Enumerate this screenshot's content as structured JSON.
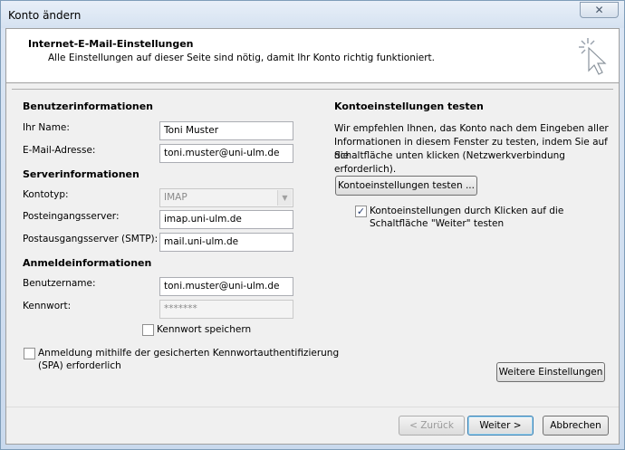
{
  "window": {
    "title": "Konto ändern",
    "close_label": "✕"
  },
  "header": {
    "title": "Internet-E-Mail-Einstellungen",
    "subtitle": "Alle Einstellungen auf dieser Seite sind nötig, damit Ihr Konto richtig funktioniert."
  },
  "user_info": {
    "section_title": "Benutzerinformationen",
    "name_label": "Ihr Name:",
    "name_value": "Toni Muster",
    "email_label": "E-Mail-Adresse:",
    "email_value": "toni.muster@uni-ulm.de"
  },
  "server_info": {
    "section_title": "Serverinformationen",
    "account_type_label": "Kontotyp:",
    "account_type_value": "IMAP",
    "incoming_label": "Posteingangsserver:",
    "incoming_value": "imap.uni-ulm.de",
    "outgoing_label": "Postausgangsserver (SMTP):",
    "outgoing_value": "mail.uni-ulm.de"
  },
  "login_info": {
    "section_title": "Anmeldeinformationen",
    "username_label": "Benutzername:",
    "username_value": "toni.muster@uni-ulm.de",
    "password_label": "Kennwort:",
    "password_value": "*******",
    "save_password_label": "Kennwort speichern",
    "save_password_checked": false,
    "spa_label_line1": "Anmeldung mithilfe der gesicherten Kennwortauthentifizierung",
    "spa_label_line2": "(SPA) erforderlich",
    "spa_checked": false
  },
  "test_settings": {
    "section_title": "Kontoeinstellungen testen",
    "description_line1": "Wir empfehlen Ihnen, das Konto nach dem Eingeben aller",
    "description_line2": "Informationen in diesem Fenster zu testen, indem Sie auf die",
    "description_line3": "Schaltfläche unten klicken (Netzwerkverbindung erforderlich).",
    "test_button": "Kontoeinstellungen testen ...",
    "auto_test_label_line1": "Kontoeinstellungen durch Klicken auf die",
    "auto_test_label_line2": "Schaltfläche \"Weiter\" testen",
    "auto_test_checked": true,
    "more_settings_button": "Weitere Einstellungen"
  },
  "footer": {
    "back_button": "< Zurück",
    "next_button": "Weiter >",
    "cancel_button": "Abbrechen"
  },
  "colors": {
    "accent_border": "#3c7fb1",
    "checkmark": "#243b6e"
  }
}
